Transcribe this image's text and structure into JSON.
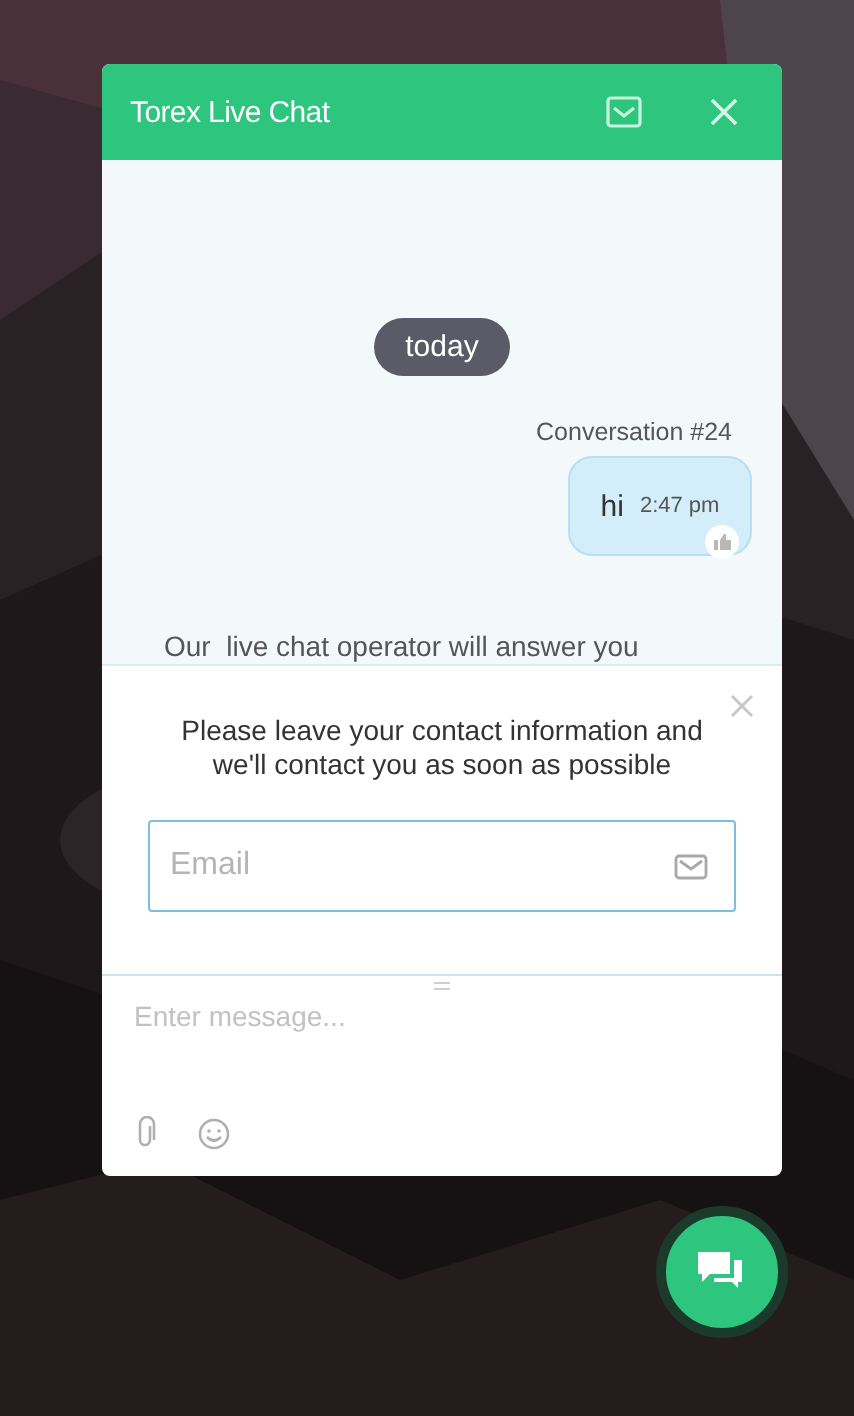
{
  "header": {
    "title": "Torex Live Chat"
  },
  "messages": {
    "date_divider": "today",
    "conversation_label": "Conversation #24",
    "items": [
      {
        "kind": "visitor",
        "text": "hi",
        "time": "2:47 pm"
      }
    ],
    "operator_notice": "Our  live chat operator will answer you"
  },
  "contact_form": {
    "prompt": "Please leave your contact information and we'll contact you as soon as possible",
    "email": {
      "placeholder": "Email"
    }
  },
  "composer": {
    "placeholder": "Enter message..."
  }
}
